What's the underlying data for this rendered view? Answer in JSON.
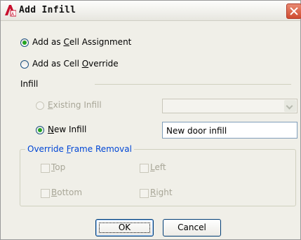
{
  "window": {
    "title": "Add Infill",
    "app_icon": "autocad-architecture-icon",
    "close_icon": "close-icon"
  },
  "assignment": {
    "cell_assignment_label": "Add as Cell Assignment",
    "cell_assignment_selected": true,
    "cell_override_label": "Add as Cell Override",
    "cell_override_selected": false
  },
  "infill": {
    "section_label": "Infill",
    "existing_label": "Existing Infill",
    "existing_enabled": false,
    "existing_value": "",
    "new_label": "New Infill",
    "new_selected": true,
    "new_value": "New door infill"
  },
  "override_frame_removal": {
    "group_label": "Override Frame Removal",
    "enabled": false,
    "top_label": "Top",
    "left_label": "Left",
    "bottom_label": "Bottom",
    "right_label": "Right"
  },
  "buttons": {
    "ok_label": "OK",
    "cancel_label": "Cancel"
  },
  "colors": {
    "group_title": "#0046d5",
    "radio_dot": "#23a423",
    "close_button": "#cf4b2f"
  }
}
